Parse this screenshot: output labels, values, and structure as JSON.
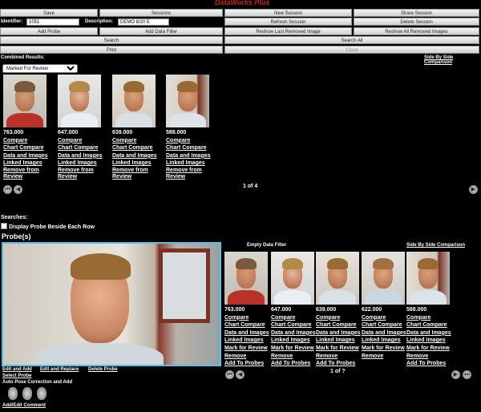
{
  "app": {
    "logo": "DataWorks Plus"
  },
  "toolbar": {
    "save": "Save",
    "sessions": "Sessions",
    "new_session": "New Session",
    "share_session": "Share Session",
    "refresh_session": "Refresh Session",
    "delete_session": "Delete Session",
    "add_probe": "Add Probe",
    "add_data_filter": "Add Data Filter",
    "reshow_last": "Reshow Last Removed Image",
    "reshow_all": "Reshow All Removed Images",
    "search": "Search",
    "search_all": "Search All",
    "print": "Print",
    "close": "Close"
  },
  "fields": {
    "identifier_label": "Identifier:",
    "identifier_value": "1051",
    "description_label": "Description:",
    "description_value": "DEMO 8/20 E"
  },
  "combined": {
    "title": "Combined Results:",
    "side_by_side": "Side By Side Comparison",
    "filter_selected": "Marked For Review",
    "page": "1 of 4",
    "results": [
      {
        "score": "763.000",
        "variant": "a"
      },
      {
        "score": "647.000",
        "variant": "b"
      },
      {
        "score": "639.000",
        "variant": "c"
      },
      {
        "score": "588.000",
        "variant": "d"
      }
    ],
    "links": {
      "compare": "Compare",
      "chart_compare": "Chart Compare",
      "data_images": "Data and Images",
      "linked_images": "Linked Images",
      "remove_1": "Remove from",
      "remove_2": "Review"
    }
  },
  "searches": {
    "title": "Searches:",
    "display_probe": "Display Probe Beside Each Row",
    "probes_title": "Probe(s)",
    "probe_actions": {
      "edit_add": "Edit and Add",
      "edit_replace": "Edit and Replace",
      "delete_probe": "Delete Probe",
      "select_probe": "Select Probe",
      "auto_pose": "Auto Pose Correction and Add",
      "add_edit_comment": "Add/Edit Comment"
    },
    "empty_filter": "Empty Data Filter",
    "side_by_side": "Side By Side Comparison",
    "page": "1 of ?",
    "results": [
      {
        "score": "763.000",
        "variant": "a"
      },
      {
        "score": "647.000",
        "variant": "b"
      },
      {
        "score": "639.000",
        "variant": "c"
      },
      {
        "score": "622.000",
        "variant": "e"
      },
      {
        "score": "588.000",
        "variant": "d"
      }
    ],
    "links": {
      "compare": "Compare",
      "chart_compare": "Chart Compare",
      "data_images": "Data and Images",
      "linked_images": "Linked Images",
      "mark_review": "Mark for Review",
      "remove": "Remove",
      "add_probes": "Add To Probes"
    }
  },
  "colors": {
    "probe_border": "#4fc3e8",
    "logo": "#c62020"
  }
}
